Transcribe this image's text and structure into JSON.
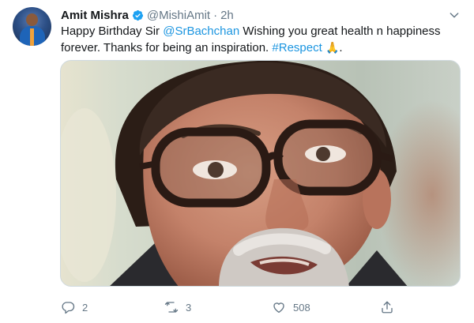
{
  "tweet": {
    "author_name": "Amit Mishra",
    "handle": "@MishiAmit",
    "separator": "·",
    "time": "2h",
    "text_line1_start": "Happy Birthday Sir ",
    "mention": "@SrBachchan",
    "text_line1_end": " Wishing you great health n happiness",
    "text_line2_start": "forever. Thanks for being an inspiration. ",
    "hashtag": "#Respect",
    "emoji": "🙏",
    "text_line2_end": ".",
    "icons": {
      "verified": "verified-badge-icon",
      "more": "chevron-down-icon",
      "reply": "reply-icon",
      "retweet": "retweet-icon",
      "like": "heart-icon",
      "share": "share-icon"
    },
    "colors": {
      "link": "#1b95e0",
      "muted": "#657786",
      "verified": "#1da1f2"
    }
  },
  "actions": {
    "reply_count": "2",
    "retweet_count": "3",
    "like_count": "508"
  }
}
